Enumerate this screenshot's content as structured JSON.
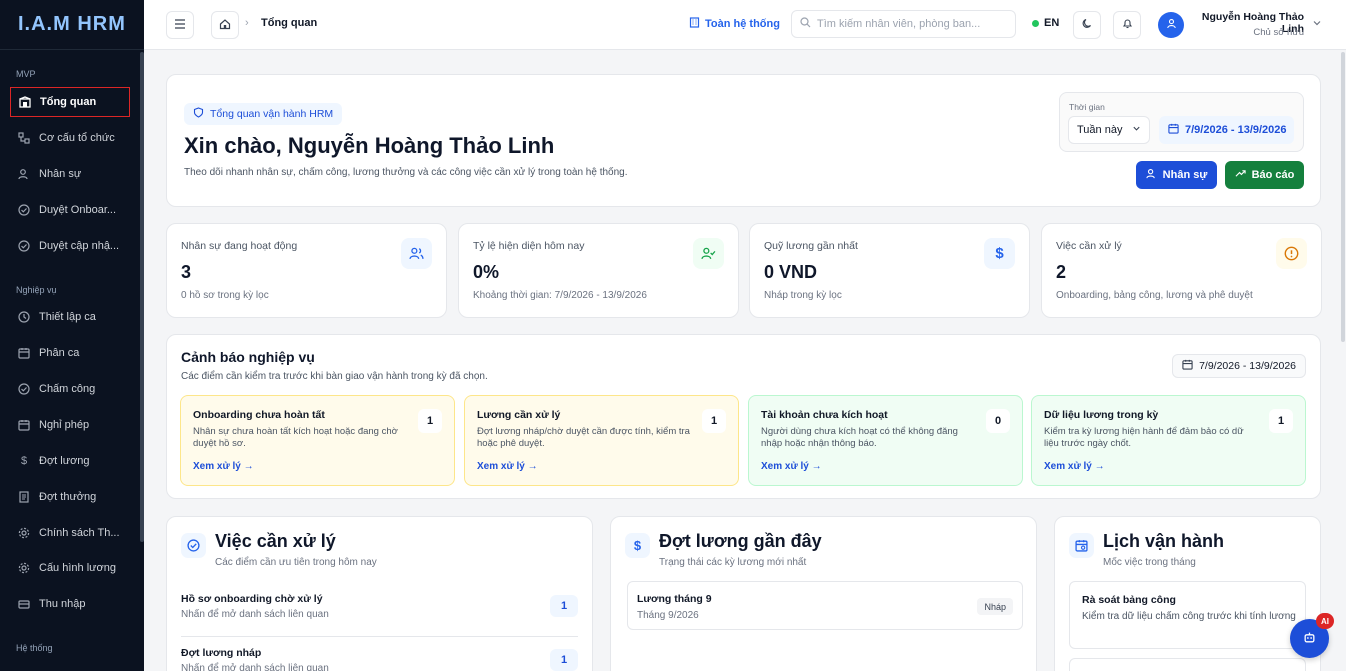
{
  "app": {
    "logo": "I.A.M HRM"
  },
  "sidebar": {
    "groups": [
      "MVP",
      "Nghiệp vụ",
      "Hệ thống"
    ],
    "items": [
      {
        "label": "Tổng quan",
        "icon": "dashboard-icon"
      },
      {
        "label": "Cơ cấu tổ chức",
        "icon": "org-chart-icon"
      },
      {
        "label": "Nhân sự",
        "icon": "users-icon"
      },
      {
        "label": "Duyệt Onboar...",
        "icon": "check-circle-icon"
      },
      {
        "label": "Duyệt cập nhậ...",
        "icon": "check-circle-icon"
      },
      {
        "label": "Thiết lập ca",
        "icon": "clock-icon"
      },
      {
        "label": "Phân ca",
        "icon": "calendar-icon"
      },
      {
        "label": "Chấm công",
        "icon": "check-circle-icon"
      },
      {
        "label": "Nghỉ phép",
        "icon": "calendar-icon"
      },
      {
        "label": "Đợt lương",
        "icon": "dollar-icon"
      },
      {
        "label": "Đợt thưởng",
        "icon": "receipt-icon"
      },
      {
        "label": "Chính sách Th...",
        "icon": "gear-icon"
      },
      {
        "label": "Cấu hình lương",
        "icon": "gear-icon"
      },
      {
        "label": "Thu nhập",
        "icon": "wallet-icon"
      }
    ]
  },
  "header": {
    "breadcrumb": "Tổng quan",
    "scope": "Toàn hệ thống",
    "search_placeholder": "Tìm kiếm nhân viên, phòng ban...",
    "lang": "EN",
    "user_name": "Nguyễn Hoàng Thảo Linh",
    "user_role": "Chủ sở hữu"
  },
  "hero": {
    "badge": "Tổng quan vận hành HRM",
    "title": "Xin chào, Nguyễn Hoàng Thảo Linh",
    "subtitle": "Theo dõi nhanh nhân sự, chấm công, lương thưởng và các công việc cần xử lý trong toàn hệ thống.",
    "period_label": "Thời gian",
    "period_value": "Tuần này",
    "period_range": "7/9/2026 - 13/9/2026",
    "btn_staff": "Nhân sự",
    "btn_report": "Báo cáo"
  },
  "stats": [
    {
      "title": "Nhân sự đang hoạt động",
      "value": "3",
      "desc": "0 hồ sơ trong kỳ lọc"
    },
    {
      "title": "Tỷ lệ hiện diện hôm nay",
      "value": "0%",
      "desc": "Khoảng thời gian: 7/9/2026 - 13/9/2026"
    },
    {
      "title": "Quỹ lương gần nhất",
      "value": "0 VND",
      "desc": "Nháp trong kỳ lọc"
    },
    {
      "title": "Việc cần xử lý",
      "value": "2",
      "desc": "Onboarding, bảng công, lương và phê duyệt"
    }
  ],
  "warnings": {
    "title": "Cảnh báo nghiệp vụ",
    "subtitle": "Các điểm cần kiểm tra trước khi bàn giao vận hành trong kỳ đã chọn.",
    "range": "7/9/2026 - 13/9/2026",
    "link": "Xem xử lý →",
    "items": [
      {
        "title": "Onboarding chưa hoàn tất",
        "desc": "Nhân sự chưa hoàn tất kích hoạt hoặc đang chờ duyệt hồ sơ.",
        "count": "1"
      },
      {
        "title": "Lương cần xử lý",
        "desc": "Đợt lương nháp/chờ duyệt cần được tính, kiểm tra hoặc phê duyệt.",
        "count": "1"
      },
      {
        "title": "Tài khoản chưa kích hoạt",
        "desc": "Người dùng chưa kích hoạt có thể không đăng nhập hoặc nhận thông báo.",
        "count": "0"
      },
      {
        "title": "Dữ liệu lương trong kỳ",
        "desc": "Kiểm tra kỳ lương hiện hành để đảm bảo có dữ liệu trước ngày chốt.",
        "count": "1"
      }
    ]
  },
  "tasks": {
    "title": "Việc cần xử lý",
    "subtitle": "Các điểm cần ưu tiên trong hôm nay",
    "items": [
      {
        "title": "Hồ sơ onboarding chờ xử lý",
        "desc": "Nhấn để mở danh sách liên quan",
        "count": "1"
      },
      {
        "title": "Đợt lương nháp",
        "desc": "Nhấn để mở danh sách liên quan",
        "count": "1"
      }
    ]
  },
  "payroll": {
    "title": "Đợt lương gần đây",
    "subtitle": "Trạng thái các kỳ lương mới nhất",
    "item": {
      "name": "Lương tháng 9",
      "month": "Tháng 9/2026",
      "status": "Nháp"
    }
  },
  "schedule": {
    "title": "Lịch vận hành",
    "subtitle": "Mốc việc trong tháng",
    "item": {
      "name": "Rà soát bảng công",
      "desc": "Kiểm tra dữ liệu chấm công trước khi tính lương"
    }
  },
  "fab": {
    "badge": "AI"
  }
}
